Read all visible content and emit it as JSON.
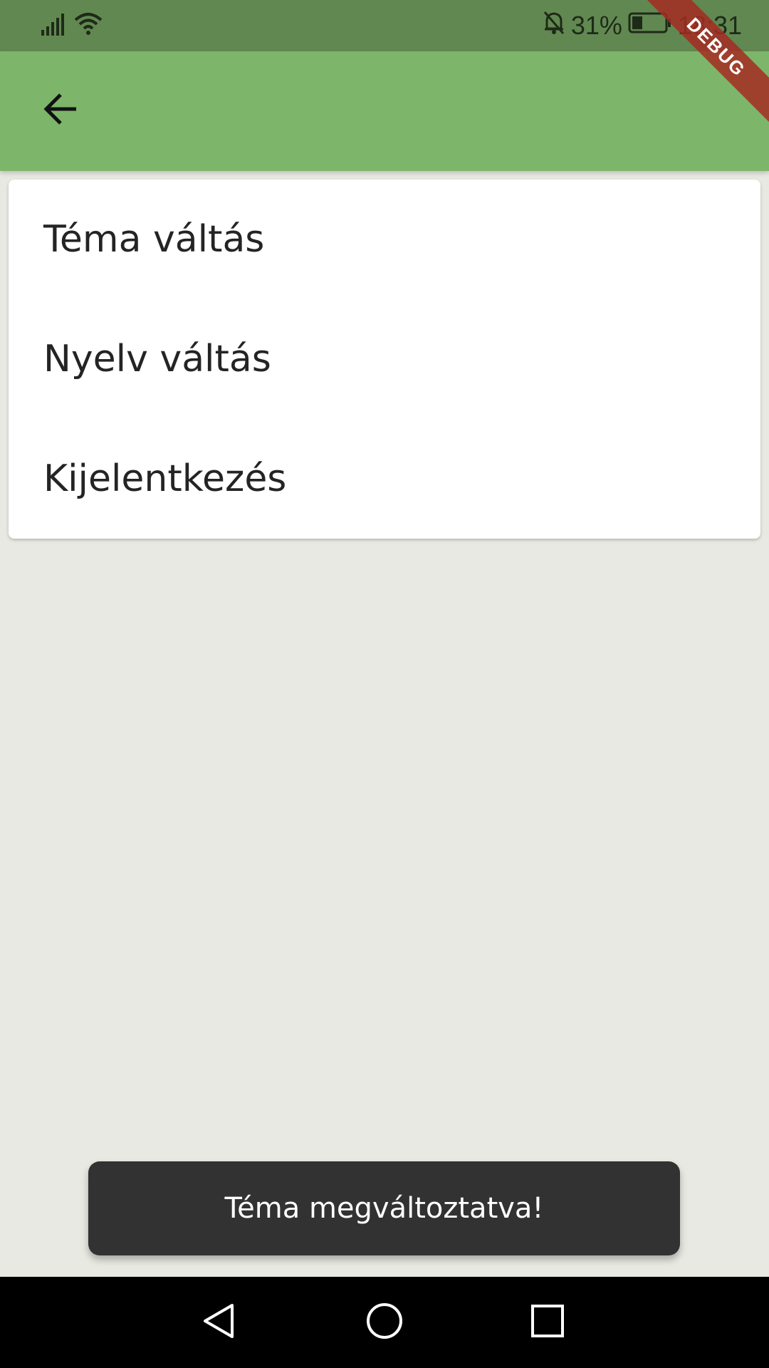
{
  "status_bar": {
    "battery_percent": "31%",
    "time": "18:31",
    "battery_level": 0.31,
    "icons": [
      "signal-icon",
      "wifi-icon",
      "notifications-off-icon",
      "battery-icon"
    ]
  },
  "app_bar": {
    "back_icon": "arrow-back-icon",
    "background_color": "#7db56b"
  },
  "debug_banner": {
    "label": "DEBUG"
  },
  "menu": {
    "items": [
      {
        "label": "Téma váltás"
      },
      {
        "label": "Nyelv váltás"
      },
      {
        "label": "Kijelentkezés"
      }
    ]
  },
  "snackbar": {
    "message": "Téma megváltoztatva!"
  },
  "nav_bar": {
    "buttons": [
      "back-triangle-icon",
      "home-circle-icon",
      "recents-square-icon"
    ]
  }
}
